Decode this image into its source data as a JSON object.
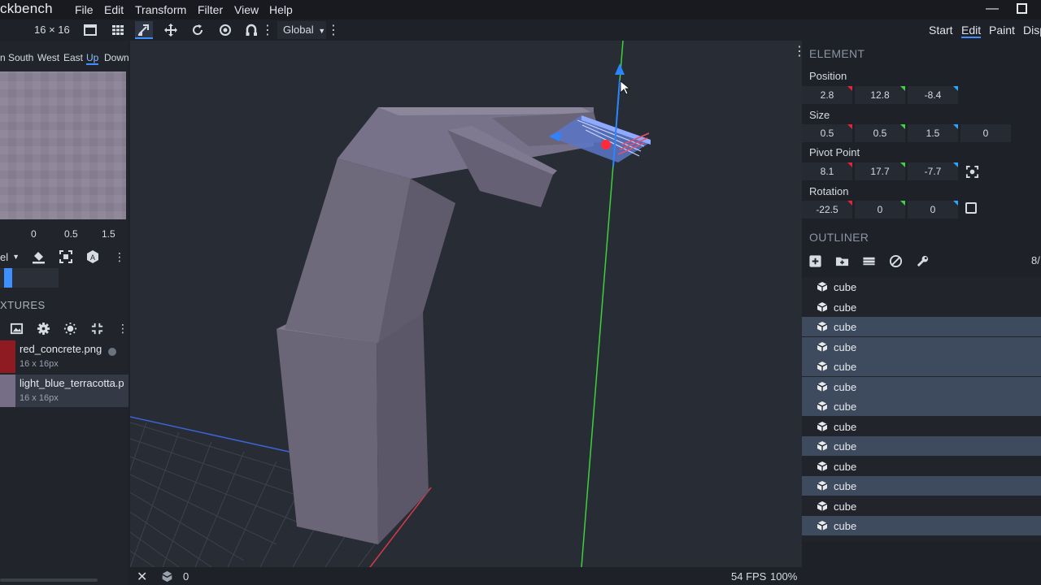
{
  "app": {
    "title": "ckbench"
  },
  "menu": [
    "File",
    "Edit",
    "Transform",
    "Filter",
    "View",
    "Help"
  ],
  "window": {
    "minimize": "—"
  },
  "toolbar": {
    "grid_size": "16 × 16",
    "transform_space": "Global",
    "modes": [
      "Start",
      "Edit",
      "Paint",
      "Disp"
    ]
  },
  "uv": {
    "faces": [
      "South",
      "West",
      "East",
      "Up",
      "Down"
    ],
    "active_face": "Up",
    "face_prefix": "n",
    "values": [
      "0",
      "0.5",
      "1.5"
    ],
    "mode_partial": "el"
  },
  "textures": {
    "title": "XTURES",
    "items": [
      {
        "name": "red_concrete.png",
        "size": "16 x 16px",
        "color": "#8e1a22"
      },
      {
        "name": "light_blue_terracotta.p",
        "size": "16 x 16px",
        "color": "#756e86"
      }
    ]
  },
  "element": {
    "title": "ELEMENT",
    "position": {
      "label": "Position",
      "values": [
        "2.8",
        "12.8",
        "-8.4"
      ]
    },
    "size": {
      "label": "Size",
      "values": [
        "0.5",
        "0.5",
        "1.5",
        "0"
      ]
    },
    "pivot": {
      "label": "Pivot Point",
      "values": [
        "8.1",
        "17.7",
        "-7.7"
      ]
    },
    "rotation": {
      "label": "Rotation",
      "values": [
        "-22.5",
        "0",
        "0"
      ]
    }
  },
  "outliner": {
    "title": "OUTLINER",
    "count": "8/",
    "items": [
      {
        "label": "cube",
        "selected": false
      },
      {
        "label": "cube",
        "selected": false
      },
      {
        "label": "cube",
        "selected": true
      },
      {
        "label": "cube",
        "selected": true
      },
      {
        "label": "cube",
        "selected": true
      },
      {
        "label": "cube",
        "selected": true
      },
      {
        "label": "cube",
        "selected": true
      },
      {
        "label": "cube",
        "selected": false
      },
      {
        "label": "cube",
        "selected": true
      },
      {
        "label": "cube",
        "selected": false
      },
      {
        "label": "cube",
        "selected": true
      },
      {
        "label": "cube",
        "selected": false
      },
      {
        "label": "cube",
        "selected": true
      }
    ]
  },
  "status": {
    "count": "0",
    "fps": "54 FPS",
    "zoom": "100%"
  },
  "colors": {
    "accent": "#3e90ff",
    "axis_x": "#e7233b",
    "axis_y": "#40d33d",
    "axis_z": "#2aa6ff",
    "model": "#716b7e"
  }
}
